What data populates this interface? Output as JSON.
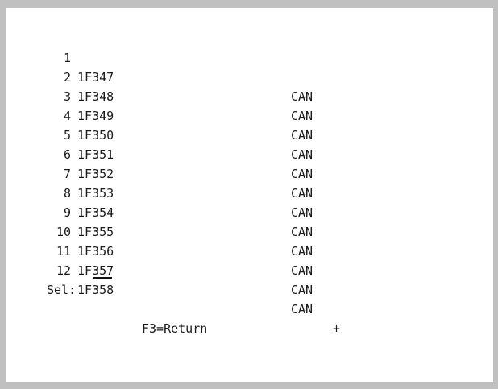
{
  "list": {
    "items": [
      {
        "num": "1",
        "code": "1F347",
        "status": "CAN",
        "more": ""
      },
      {
        "num": "2",
        "code": "1F348",
        "status": "CAN",
        "more": ""
      },
      {
        "num": "3",
        "code": "1F349",
        "status": "CAN",
        "more": ""
      },
      {
        "num": "4",
        "code": "1F350",
        "status": "CAN",
        "more": ""
      },
      {
        "num": "5",
        "code": "1F351",
        "status": "CAN",
        "more": ""
      },
      {
        "num": "6",
        "code": "1F352",
        "status": "CAN",
        "more": ""
      },
      {
        "num": "7",
        "code": "1F353",
        "status": "CAN",
        "more": ""
      },
      {
        "num": "8",
        "code": "1F354",
        "status": "CAN",
        "more": ""
      },
      {
        "num": "9",
        "code": "1F355",
        "status": "CAN",
        "more": ""
      },
      {
        "num": "10",
        "code": "1F356",
        "status": "CAN",
        "more": ""
      },
      {
        "num": "11",
        "code": "1F357",
        "status": "CAN",
        "more": ""
      },
      {
        "num": "12",
        "code": "1F358",
        "status": "CAN",
        "more": "+"
      }
    ]
  },
  "prompt": {
    "sel_label": "Sel:",
    "sel_value": "",
    "f3_label": "F3=Return"
  },
  "colors": {
    "frame": "#c0c0c0",
    "screen": "#ffffff",
    "text": "#1a1a1a"
  }
}
